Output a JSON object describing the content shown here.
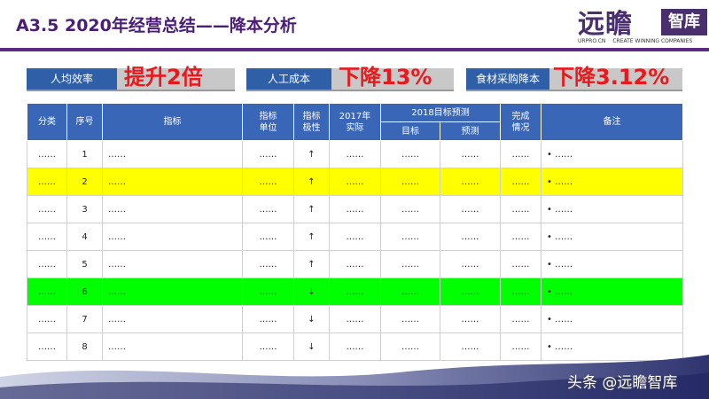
{
  "header": {
    "title": "A3.5  2020年经营总结——降本分析"
  },
  "logo": {
    "main": "远瞻",
    "side": "智库",
    "site": "URPRO.CN",
    "slogan": "CREATE WINNING COMPANIES"
  },
  "kpis": [
    {
      "label": "人均效率",
      "value": "提升2倍"
    },
    {
      "label": "人工成本",
      "value": "下降13%"
    },
    {
      "label": "食材采购降本",
      "value": "下降3.12%"
    }
  ],
  "table": {
    "headers": {
      "category": "分类",
      "seq": "序号",
      "indicator": "指标",
      "unit": "指标\n单位",
      "polarity": "指标\n极性",
      "actual2017": "2017年\n实际",
      "forecast2018": "2018目标预测",
      "target": "目标",
      "forecast": "预测",
      "status": "完成\n情况",
      "remark": "备注"
    },
    "rows": [
      {
        "category": "……",
        "seq": "1",
        "indicator": "……",
        "unit": "……",
        "polarity": "↑",
        "actual": "……",
        "target": "……",
        "forecast": "……",
        "status": "……",
        "remark": "•  ……",
        "highlight": "none"
      },
      {
        "category": "……",
        "seq": "2",
        "indicator": "……",
        "unit": "……",
        "polarity": "↑",
        "actual": "……",
        "target": "……",
        "forecast": "……",
        "status": "……",
        "remark": "•  ……",
        "highlight": "yellow"
      },
      {
        "category": "……",
        "seq": "3",
        "indicator": "……",
        "unit": "……",
        "polarity": "↑",
        "actual": "……",
        "target": "……",
        "forecast": "……",
        "status": "……",
        "remark": "•  ……",
        "highlight": "none"
      },
      {
        "category": "……",
        "seq": "4",
        "indicator": "……",
        "unit": "……",
        "polarity": "↑",
        "actual": "……",
        "target": "……",
        "forecast": "……",
        "status": "……",
        "remark": "•  ……",
        "highlight": "none"
      },
      {
        "category": "……",
        "seq": "5",
        "indicator": "……",
        "unit": "……",
        "polarity": "↑",
        "actual": "……",
        "target": "……",
        "forecast": "……",
        "status": "……",
        "remark": "•  ……",
        "highlight": "none"
      },
      {
        "category": "……",
        "seq": "6",
        "indicator": "……",
        "unit": "……",
        "polarity": "↓",
        "actual": "……",
        "target": "……",
        "forecast": "……",
        "status": "……",
        "remark": "•  ……",
        "highlight": "green"
      },
      {
        "category": "……",
        "seq": "7",
        "indicator": "……",
        "unit": "……",
        "polarity": "↓",
        "actual": "……",
        "target": "……",
        "forecast": "……",
        "status": "……",
        "remark": "•  ……",
        "highlight": "none"
      },
      {
        "category": "……",
        "seq": "8",
        "indicator": "……",
        "unit": "……",
        "polarity": "↓",
        "actual": "……",
        "target": "……",
        "forecast": "……",
        "status": "……",
        "remark": "•  ……",
        "highlight": "none"
      }
    ]
  },
  "watermark": "头条 @远瞻智库",
  "colors": {
    "title": "#4a1e78",
    "header_blue": "#3a66b7",
    "kpi_red": "#e8191c",
    "highlight_yellow": "#ffff00",
    "highlight_green": "#00ff00"
  }
}
